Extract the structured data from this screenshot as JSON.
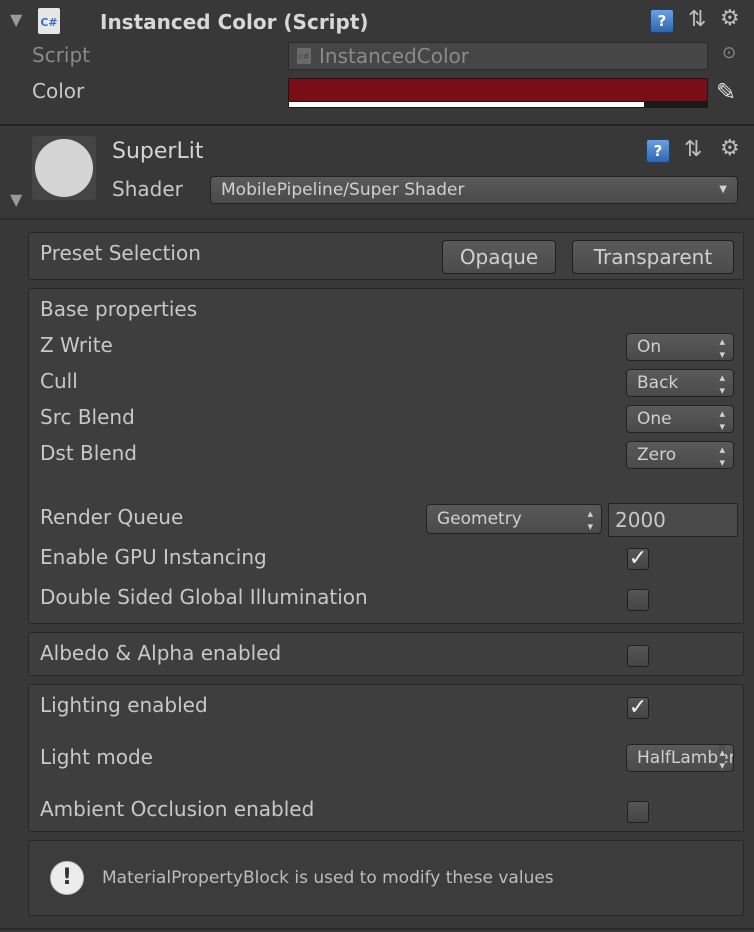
{
  "script_component": {
    "title": "Instanced Color (Script)",
    "icon_label": "C#",
    "script_label": "Script",
    "script_value": "InstancedColor",
    "script_file_icon_label": "c#",
    "color_label": "Color",
    "color_value": "#7a0e16",
    "alpha_fraction": 0.85
  },
  "material": {
    "name": "SuperLit",
    "shader_label": "Shader",
    "shader_value": "MobilePipeline/Super Shader"
  },
  "preset": {
    "label": "Preset Selection",
    "opaque": "Opaque",
    "transparent": "Transparent"
  },
  "base": {
    "title": "Base properties",
    "zwrite_label": "Z Write",
    "zwrite_value": "On",
    "cull_label": "Cull",
    "cull_value": "Back",
    "src_label": "Src Blend",
    "src_value": "One",
    "dst_label": "Dst Blend",
    "dst_value": "Zero",
    "rq_label": "Render Queue",
    "rq_dropdown": "Geometry",
    "rq_value": "2000",
    "gpu_label": "Enable GPU Instancing",
    "gpu_checked": true,
    "dsgi_label": "Double Sided Global Illumination",
    "dsgi_checked": false
  },
  "albedo": {
    "label": "Albedo & Alpha enabled",
    "checked": false
  },
  "lighting": {
    "enabled_label": "Lighting enabled",
    "enabled_checked": true,
    "mode_label": "Light mode",
    "mode_value": "HalfLambert",
    "ao_label": "Ambient Occlusion enabled",
    "ao_checked": false
  },
  "info": {
    "message": "MaterialPropertyBlock is used to modify these values"
  },
  "icons": {
    "help": "?",
    "settings": "⇅",
    "gear": "⚙",
    "foldout": "▼",
    "eyedropper": "✎",
    "target": "⊙",
    "warning": "!"
  }
}
